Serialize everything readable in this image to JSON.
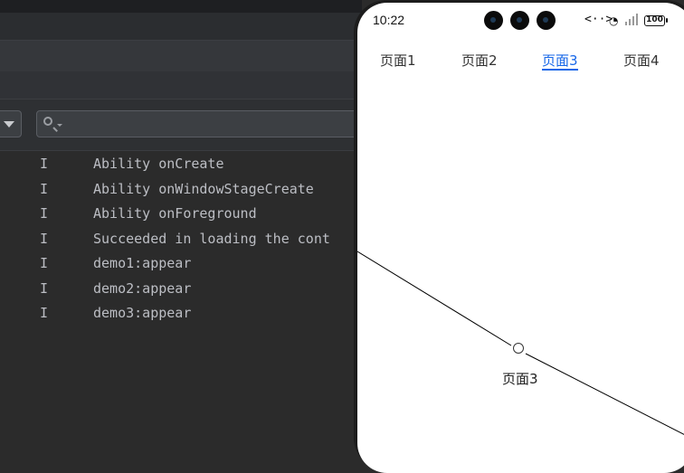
{
  "log": {
    "rows": [
      {
        "level": "I",
        "message": "Ability onCreate"
      },
      {
        "level": "I",
        "message": "Ability onWindowStageCreate"
      },
      {
        "level": "I",
        "message": "Ability onForeground"
      },
      {
        "level": "I",
        "message": "Succeeded in loading the cont"
      },
      {
        "level": "I",
        "message": "demo1:appear"
      },
      {
        "level": "I",
        "message": "demo2:appear"
      },
      {
        "level": "I",
        "message": "demo3:appear"
      }
    ]
  },
  "phone": {
    "status": {
      "time": "10:22",
      "code_icon": "<··>",
      "battery": "100"
    },
    "tabs": [
      {
        "label": "页面1"
      },
      {
        "label": "页面2"
      },
      {
        "label": "页面3",
        "active": true
      },
      {
        "label": "页面4"
      }
    ],
    "page_label": "页面3",
    "accent_color": "#1767e8"
  }
}
